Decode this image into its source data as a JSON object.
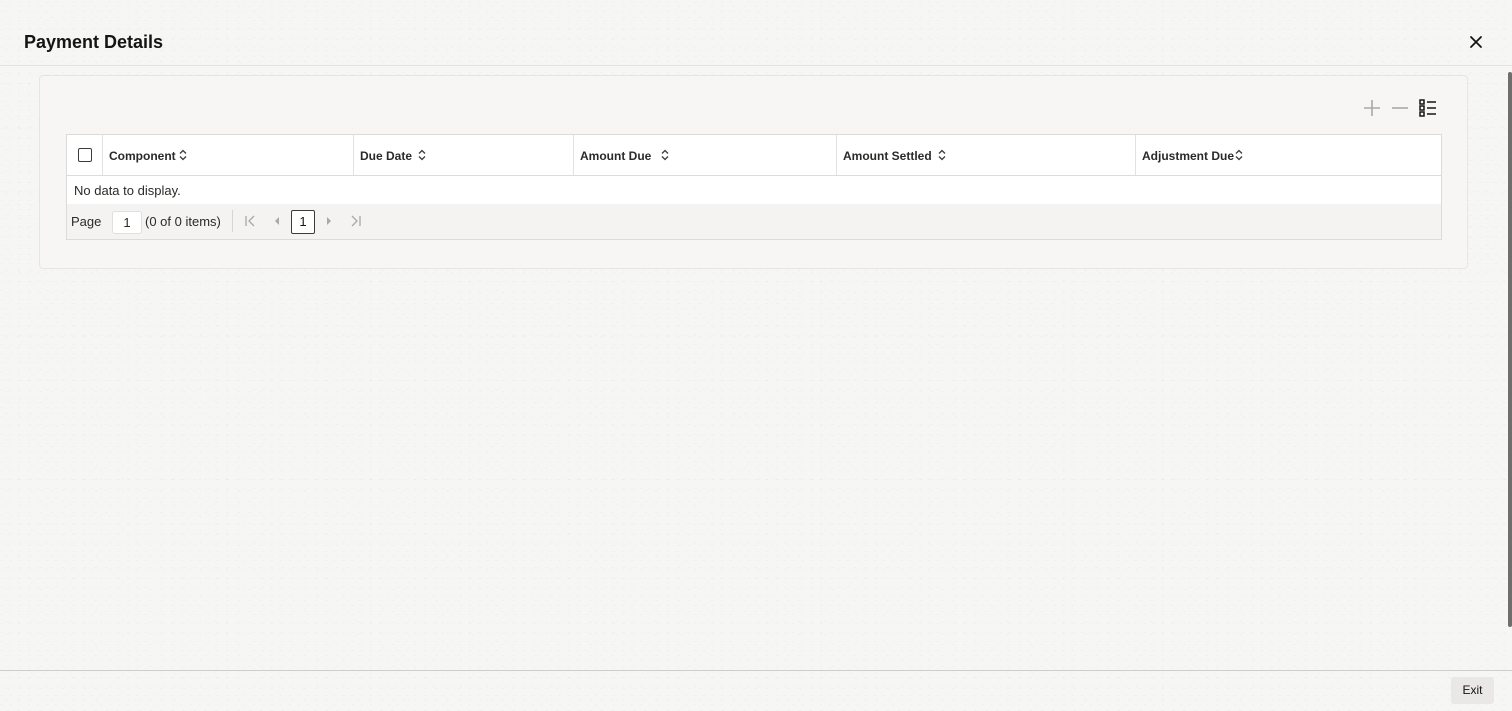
{
  "dialog": {
    "title": "Payment Details"
  },
  "table": {
    "columns": [
      {
        "label": "Component"
      },
      {
        "label": "Due Date"
      },
      {
        "label": "Amount Due"
      },
      {
        "label": "Amount Settled"
      },
      {
        "label": "Adjustment Due"
      }
    ],
    "empty_message": "No data to display."
  },
  "pagination": {
    "page_label": "Page",
    "page_value": "1",
    "items_summary": "(0 of 0 items)",
    "current_page": "1"
  },
  "footer": {
    "exit_label": "Exit"
  },
  "icons": {
    "close": "close-icon",
    "add": "plus-icon",
    "remove": "minus-icon",
    "columns": "column-list-icon",
    "sort": "sort-icon",
    "first": "first-page-icon",
    "prev": "previous-page-icon",
    "next": "next-page-icon",
    "last": "last-page-icon"
  }
}
